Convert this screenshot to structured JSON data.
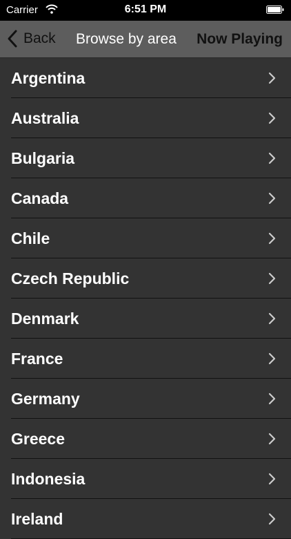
{
  "status_bar": {
    "carrier": "Carrier",
    "time": "6:51 PM",
    "icons": [
      "wifi-icon",
      "battery-icon"
    ]
  },
  "nav_bar": {
    "back_label": "Back",
    "title": "Browse by area",
    "now_playing_label": "Now Playing"
  },
  "areas": [
    {
      "label": "Argentina"
    },
    {
      "label": "Australia"
    },
    {
      "label": "Bulgaria"
    },
    {
      "label": "Canada"
    },
    {
      "label": "Chile"
    },
    {
      "label": "Czech Republic"
    },
    {
      "label": "Denmark"
    },
    {
      "label": "France"
    },
    {
      "label": "Germany"
    },
    {
      "label": "Greece"
    },
    {
      "label": "Indonesia"
    },
    {
      "label": "Ireland"
    }
  ],
  "colors": {
    "background": "#333333",
    "nav_bar": "#5d5d5d",
    "status_bar": "#000000",
    "separator": "#111111",
    "text": "#ffffff",
    "nav_button_text": "#111111",
    "disclosure": "#cccccc"
  }
}
